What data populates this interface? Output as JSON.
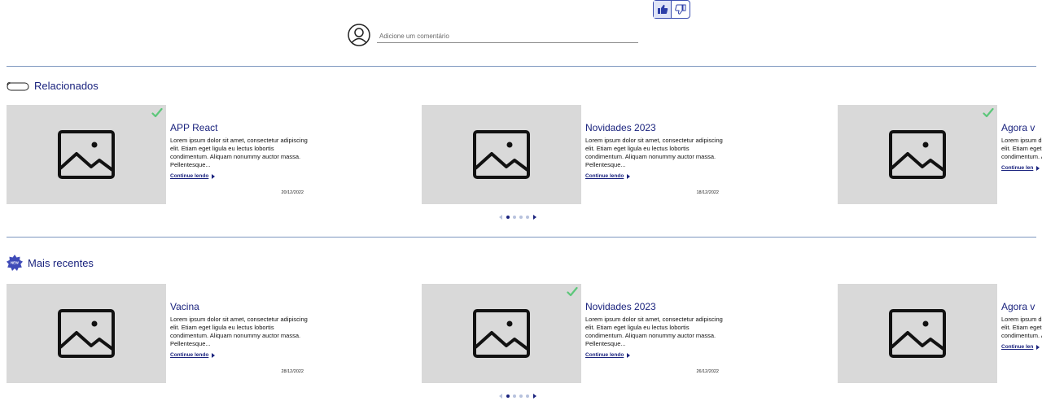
{
  "comment": {
    "placeholder": "Adicione um comentário"
  },
  "reactions": {
    "like_icon": "thumbs-up-icon",
    "dislike_icon": "thumbs-down-icon",
    "accent": "#3a4db0"
  },
  "sections": {
    "related": {
      "title": "Relacionados",
      "icon": "pill-icon",
      "cards": [
        {
          "title": "APP React",
          "excerpt": "Lorem ipsum dolor sit amet, consectetur adipiscing elit. Etiam eget ligula eu lectus lobortis condimentum. Aliquam nonummy auctor massa. Pellentesque...",
          "link": "Continue lendo",
          "date": "20/12/2022",
          "checked": true
        },
        {
          "title": "Novidades 2023",
          "excerpt": "Lorem ipsum dolor sit amet, consectetur adipiscing elit. Etiam eget ligula eu lectus lobortis condimentum. Aliquam nonummy auctor massa. Pellentesque...",
          "link": "Continue lendo",
          "date": "18/12/2022",
          "checked": false
        },
        {
          "title": "Agora v",
          "excerpt": "Lorem ipsum dolor sit amet, consectetur adipiscing elit. Etiam eget ligula eu lectus lobortis condimentum. Aliquam nonummy auctor massa",
          "link": "Continue len",
          "date": "",
          "checked": true
        }
      ]
    },
    "recent": {
      "title": "Mais recentes",
      "icon": "new-badge-icon",
      "cards": [
        {
          "title": "Vacina",
          "excerpt": "Lorem ipsum dolor sit amet, consectetur adipiscing elit. Etiam eget ligula eu lectus lobortis condimentum. Aliquam nonummy auctor massa. Pellentesque...",
          "link": "Continue lendo",
          "date": "28/12/2022",
          "checked": false
        },
        {
          "title": "Novidades 2023",
          "excerpt": "Lorem ipsum dolor sit amet, consectetur adipiscing elit. Etiam eget ligula eu lectus lobortis condimentum. Aliquam nonummy auctor massa. Pellentesque...",
          "link": "Continue lendo",
          "date": "26/12/2022",
          "checked": true
        },
        {
          "title": "Agora v",
          "excerpt": "Lorem ipsum dolor sit amet, consectetur adipiscing elit. Etiam eget ligula eu lectus lobortis condimentum. Aliquam nonummy auctor massa",
          "link": "Continue len",
          "date": "",
          "checked": false
        }
      ]
    }
  },
  "pager": {
    "dots": 4,
    "active_index": 0
  },
  "colors": {
    "brand_navy": "#1a237e",
    "thumb_bg": "#d9d9d9",
    "check_green": "#5cc77a"
  }
}
